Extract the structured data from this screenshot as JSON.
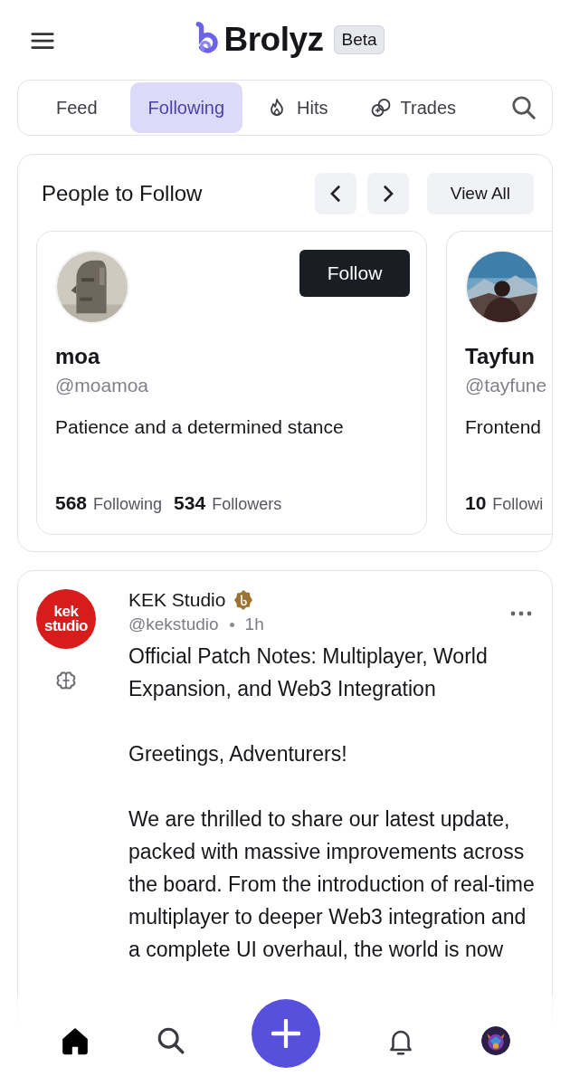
{
  "header": {
    "brand": "Brolyz",
    "badge": "Beta"
  },
  "tabs": [
    {
      "label": "Feed",
      "kind": "plain",
      "selected": false
    },
    {
      "label": "Following",
      "kind": "plain",
      "selected": true
    },
    {
      "label": "Hits",
      "kind": "flame",
      "selected": false
    },
    {
      "label": "Trades",
      "kind": "link",
      "selected": false
    }
  ],
  "people": {
    "title": "People to Follow",
    "view_all": "View All",
    "cards": [
      {
        "name": "moa",
        "handle": "@moamoa",
        "bio": "Patience and a determined stance",
        "follow": "Follow",
        "following_count": "568",
        "following_label": "Following",
        "followers_count": "534",
        "followers_label": "Followers"
      },
      {
        "name": "Tayfun",
        "handle": "@tayfune",
        "bio": "Frontend",
        "following_count": "10",
        "following_label": "Followi"
      }
    ]
  },
  "post": {
    "avatar_text": "kek studio",
    "author": "KEK Studio",
    "handle": "@kekstudio",
    "time": "1h",
    "paragraphs": [
      "Official Patch Notes: Multiplayer, World Expansion, and Web3 Integration",
      "Greetings, Adventurers!",
      "We are thrilled to share our latest update, packed with massive improvements across the board. From the introduction of real-time multiplayer to deeper Web3 integration and a complete UI overhaul, the world is now"
    ]
  },
  "bottom_nav": [
    {
      "kind": "home",
      "selected": true
    },
    {
      "kind": "search",
      "selected": false
    },
    {
      "kind": "add",
      "selected": false
    },
    {
      "kind": "bell",
      "selected": false
    },
    {
      "kind": "avatar",
      "selected": false
    }
  ]
}
